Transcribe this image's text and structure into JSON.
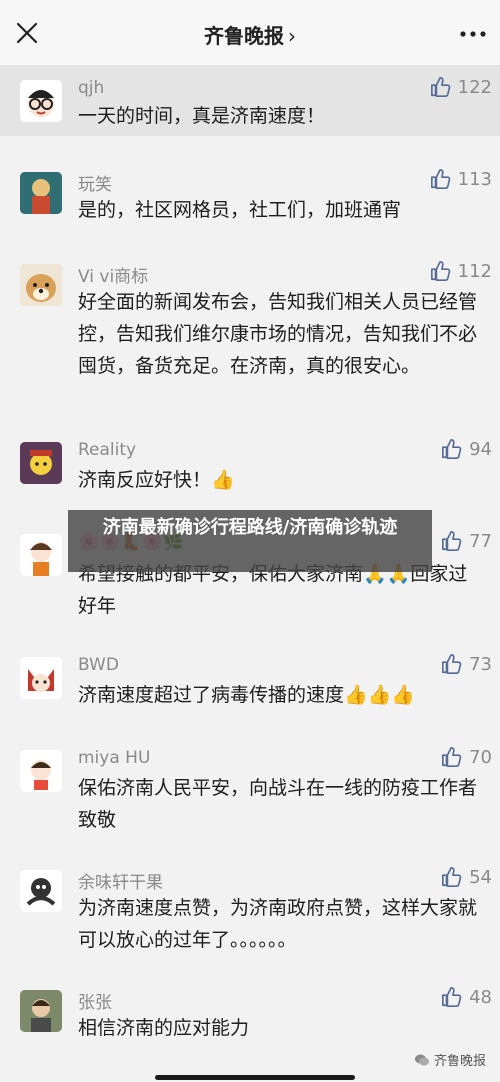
{
  "header": {
    "title": "齐鲁晚报",
    "chevron": "›"
  },
  "comments": [
    {
      "name": "qjh",
      "likes": "122",
      "text": "一天的时间，真是济南速度！",
      "avatar": "cartoon-glasses-avatar"
    },
    {
      "name": "玩笑",
      "likes": "113",
      "text": "是的，社区网格员，社工们，加班通宵",
      "avatar": "photo-avatar"
    },
    {
      "name": "Vi vi商标",
      "likes": "112",
      "text": "好全面的新闻发布会，告知我们相关人员已经管控，告知我们维尔康市场的情况，告知我们不必囤货，备货充足。在济南，真的很安心。",
      "avatar": "dog-avatar"
    },
    {
      "name": "Reality",
      "likes": "94",
      "text": "济南反应好快！👍",
      "avatar": "cartoon-avatar"
    },
    {
      "name": "🌸🌸👢🌸🌿",
      "likes": "77",
      "text": "希望接触的都平安，保佑大家济南🙏🙏回家过好年",
      "avatar": "girl-avatar"
    },
    {
      "name": "BWD",
      "likes": "73",
      "text": "济南速度超过了病毒传播的速度👍👍👍",
      "avatar": "cat-avatar"
    },
    {
      "name": "miya HU",
      "likes": "70",
      "text": "保佑济南人民平安，向战斗在一线的防疫工作者致敬",
      "avatar": "doll-avatar"
    },
    {
      "name": "余味轩干果",
      "likes": "54",
      "text": "为济南速度点赞，为济南政府点赞，这样大家就可以放心的过年了。。。。。。",
      "avatar": "logo-avatar"
    },
    {
      "name": "张张",
      "likes": "48",
      "text": "相信济南的应对能力",
      "avatar": "portrait-avatar"
    }
  ],
  "banner": {
    "text": "济南最新确诊行程路线/济南确诊轨迹"
  },
  "watermark": {
    "text": "齐鲁晚报"
  },
  "colors": {
    "accent": "#576b95",
    "highlight": "#e4e4e4",
    "background": "#f2f2f2"
  }
}
